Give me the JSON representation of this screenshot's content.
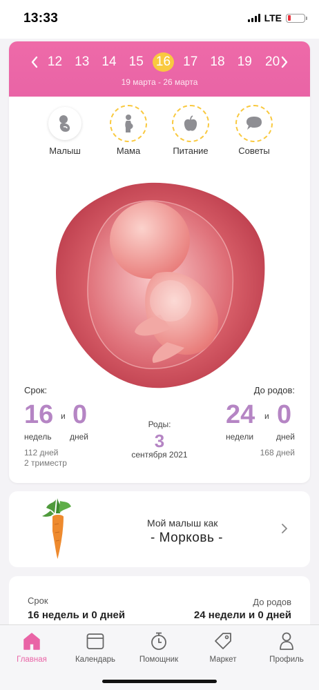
{
  "status_bar": {
    "time": "13:33",
    "network": "LTE"
  },
  "week_selector": {
    "weeks": [
      "12",
      "13",
      "14",
      "15",
      "16",
      "17",
      "18",
      "19",
      "20"
    ],
    "selected": "16",
    "date_range": "19 марта - 26 марта"
  },
  "category_tabs": [
    {
      "label": "Малыш",
      "icon": "baby-icon"
    },
    {
      "label": "Мама",
      "icon": "pregnant-woman-icon"
    },
    {
      "label": "Питание",
      "icon": "apple-icon"
    },
    {
      "label": "Советы",
      "icon": "chat-bubble-icon"
    }
  ],
  "stats": {
    "term_label": "Срок:",
    "term_weeks": "16",
    "term_and": "и",
    "term_days": "0",
    "term_weeks_unit": "недель",
    "term_days_unit": "дней",
    "term_total_days": "112 дней",
    "trimester": "2 триместр",
    "birth_label": "Роды:",
    "birth_day": "3",
    "birth_month": "сентября 2021",
    "until_label": "До родов:",
    "until_weeks": "24",
    "until_and": "и",
    "until_days": "0",
    "until_weeks_unit": "недели",
    "until_days_unit": "дней",
    "until_total_days": "168 дней"
  },
  "fruit": {
    "title": "Мой малыш как",
    "name": "- Морковь -"
  },
  "summary": {
    "term_label": "Срок",
    "term_value": "16 недель и 0 дней",
    "until_label": "До родов",
    "until_value": "24 недели и 0 дней"
  },
  "tab_bar": [
    {
      "label": "Главная",
      "icon": "home-icon",
      "active": true
    },
    {
      "label": "Календарь",
      "icon": "calendar-icon",
      "active": false
    },
    {
      "label": "Помощник",
      "icon": "stopwatch-icon",
      "active": false
    },
    {
      "label": "Маркет",
      "icon": "tag-icon",
      "active": false
    },
    {
      "label": "Профиль",
      "icon": "person-icon",
      "active": false
    }
  ],
  "colors": {
    "header_pink": "#e964a6",
    "selected_week": "#f9c93f",
    "accent_purple": "#b585c4",
    "active_tab": "#e964a6"
  }
}
